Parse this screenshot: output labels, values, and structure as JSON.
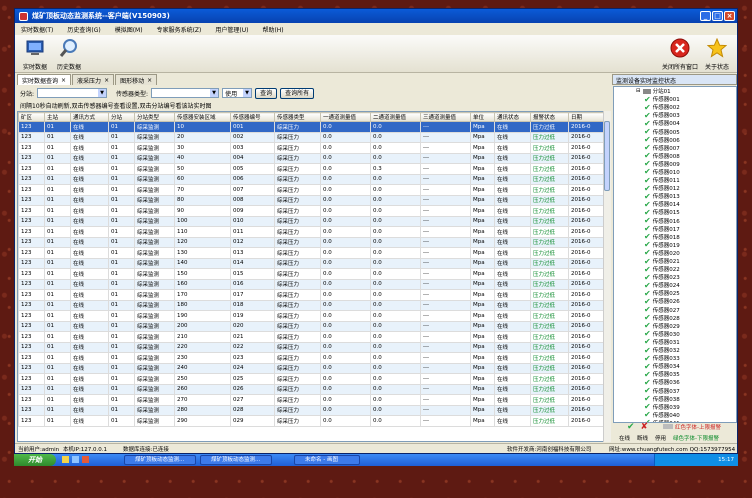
{
  "window": {
    "title": "煤矿顶板动态监测系统--客户端(V150903)"
  },
  "menu": [
    "实时数据(T)",
    "历史查询(G)",
    "模拟图(M)",
    "专家服务系统(Z)",
    "用户管理(U)",
    "帮助(H)"
  ],
  "toolbar": {
    "realtime": "实时数据",
    "history": "历史数据",
    "close_all": "关闭所有窗口",
    "about": "关于状态"
  },
  "tabs": [
    "实时数据查询",
    "液采压力",
    "图形移动"
  ],
  "right_header": "监测设备实时监控状态",
  "filter": {
    "substation_label": "分站:",
    "sensor_type_label": "传感器类型:",
    "use_value": "使用",
    "query_btn": "查询",
    "query_all_btn": "查询所有"
  },
  "hint": "间隔10秒自动刷新,双击传感器编号查看设置,双击分站编号看该站实时图",
  "grid": {
    "columns": [
      "矿区",
      "主站",
      "通讯方式",
      "分站",
      "分站类型",
      "传感器安装区域",
      "传感器编号",
      "传感器类型",
      "一通道测量值",
      "二通道测量值",
      "三通道测量值",
      "单位",
      "通讯状态",
      "报警状态",
      "日期"
    ],
    "rows": [
      [
        "123",
        "01",
        "在线",
        "01",
        "综采监测",
        "10",
        "001",
        "综采压力",
        "0.0",
        "0.0",
        "---",
        "Mpa",
        "在线",
        "压力过低",
        "2016-0"
      ],
      [
        "123",
        "01",
        "在线",
        "01",
        "综采监测",
        "20",
        "002",
        "综采压力",
        "0.0",
        "0.0",
        "---",
        "Mpa",
        "在线",
        "压力过低",
        "2016-0"
      ],
      [
        "123",
        "01",
        "在线",
        "01",
        "综采监测",
        "30",
        "003",
        "综采压力",
        "0.0",
        "0.0",
        "---",
        "Mpa",
        "在线",
        "压力过低",
        "2016-0"
      ],
      [
        "123",
        "01",
        "在线",
        "01",
        "综采监测",
        "40",
        "004",
        "综采压力",
        "0.0",
        "0.0",
        "---",
        "Mpa",
        "在线",
        "压力过低",
        "2016-0"
      ],
      [
        "123",
        "01",
        "在线",
        "01",
        "综采监测",
        "50",
        "005",
        "综采压力",
        "0.0",
        "0.3",
        "---",
        "Mpa",
        "在线",
        "压力过低",
        "2016-0"
      ],
      [
        "123",
        "01",
        "在线",
        "01",
        "综采监测",
        "60",
        "006",
        "综采压力",
        "0.0",
        "0.0",
        "---",
        "Mpa",
        "在线",
        "压力过低",
        "2016-0"
      ],
      [
        "123",
        "01",
        "在线",
        "01",
        "综采监测",
        "70",
        "007",
        "综采压力",
        "0.0",
        "0.0",
        "---",
        "Mpa",
        "在线",
        "压力过低",
        "2016-0"
      ],
      [
        "123",
        "01",
        "在线",
        "01",
        "综采监测",
        "80",
        "008",
        "综采压力",
        "0.0",
        "0.0",
        "---",
        "Mpa",
        "在线",
        "压力过低",
        "2016-0"
      ],
      [
        "123",
        "01",
        "在线",
        "01",
        "综采监测",
        "90",
        "009",
        "综采压力",
        "0.0",
        "0.0",
        "---",
        "Mpa",
        "在线",
        "压力过低",
        "2016-0"
      ],
      [
        "123",
        "01",
        "在线",
        "01",
        "综采监测",
        "100",
        "010",
        "综采压力",
        "0.0",
        "0.0",
        "---",
        "Mpa",
        "在线",
        "压力过低",
        "2016-0"
      ],
      [
        "123",
        "01",
        "在线",
        "01",
        "综采监测",
        "110",
        "011",
        "综采压力",
        "0.0",
        "0.0",
        "---",
        "Mpa",
        "在线",
        "压力过低",
        "2016-0"
      ],
      [
        "123",
        "01",
        "在线",
        "01",
        "综采监测",
        "120",
        "012",
        "综采压力",
        "0.0",
        "0.0",
        "---",
        "Mpa",
        "在线",
        "压力过低",
        "2016-0"
      ],
      [
        "123",
        "01",
        "在线",
        "01",
        "综采监测",
        "130",
        "013",
        "综采压力",
        "0.0",
        "0.0",
        "---",
        "Mpa",
        "在线",
        "压力过低",
        "2016-0"
      ],
      [
        "123",
        "01",
        "在线",
        "01",
        "综采监测",
        "140",
        "014",
        "综采压力",
        "0.0",
        "0.0",
        "---",
        "Mpa",
        "在线",
        "压力过低",
        "2016-0"
      ],
      [
        "123",
        "01",
        "在线",
        "01",
        "综采监测",
        "150",
        "015",
        "综采压力",
        "0.0",
        "0.0",
        "---",
        "Mpa",
        "在线",
        "压力过低",
        "2016-0"
      ],
      [
        "123",
        "01",
        "在线",
        "01",
        "综采监测",
        "160",
        "016",
        "综采压力",
        "0.0",
        "0.0",
        "---",
        "Mpa",
        "在线",
        "压力过低",
        "2016-0"
      ],
      [
        "123",
        "01",
        "在线",
        "01",
        "综采监测",
        "170",
        "017",
        "综采压力",
        "0.0",
        "0.0",
        "---",
        "Mpa",
        "在线",
        "压力过低",
        "2016-0"
      ],
      [
        "123",
        "01",
        "在线",
        "01",
        "综采监测",
        "180",
        "018",
        "综采压力",
        "0.0",
        "0.0",
        "---",
        "Mpa",
        "在线",
        "压力过低",
        "2016-0"
      ],
      [
        "123",
        "01",
        "在线",
        "01",
        "综采监测",
        "190",
        "019",
        "综采压力",
        "0.0",
        "0.0",
        "---",
        "Mpa",
        "在线",
        "压力过低",
        "2016-0"
      ],
      [
        "123",
        "01",
        "在线",
        "01",
        "综采监测",
        "200",
        "020",
        "综采压力",
        "0.0",
        "0.0",
        "---",
        "Mpa",
        "在线",
        "压力过低",
        "2016-0"
      ],
      [
        "123",
        "01",
        "在线",
        "01",
        "综采监测",
        "210",
        "021",
        "综采压力",
        "0.0",
        "0.0",
        "---",
        "Mpa",
        "在线",
        "压力过低",
        "2016-0"
      ],
      [
        "123",
        "01",
        "在线",
        "01",
        "综采监测",
        "220",
        "022",
        "综采压力",
        "0.0",
        "0.0",
        "---",
        "Mpa",
        "在线",
        "压力过低",
        "2016-0"
      ],
      [
        "123",
        "01",
        "在线",
        "01",
        "综采监测",
        "230",
        "023",
        "综采压力",
        "0.0",
        "0.0",
        "---",
        "Mpa",
        "在线",
        "压力过低",
        "2016-0"
      ],
      [
        "123",
        "01",
        "在线",
        "01",
        "综采监测",
        "240",
        "024",
        "综采压力",
        "0.0",
        "0.0",
        "---",
        "Mpa",
        "在线",
        "压力过低",
        "2016-0"
      ],
      [
        "123",
        "01",
        "在线",
        "01",
        "综采监测",
        "250",
        "025",
        "综采压力",
        "0.0",
        "0.0",
        "---",
        "Mpa",
        "在线",
        "压力过低",
        "2016-0"
      ],
      [
        "123",
        "01",
        "在线",
        "01",
        "综采监测",
        "260",
        "026",
        "综采压力",
        "0.0",
        "0.0",
        "---",
        "Mpa",
        "在线",
        "压力过低",
        "2016-0"
      ],
      [
        "123",
        "01",
        "在线",
        "01",
        "综采监测",
        "270",
        "027",
        "综采压力",
        "0.0",
        "0.0",
        "---",
        "Mpa",
        "在线",
        "压力过低",
        "2016-0"
      ],
      [
        "123",
        "01",
        "在线",
        "01",
        "综采监测",
        "280",
        "028",
        "综采压力",
        "0.0",
        "0.0",
        "---",
        "Mpa",
        "在线",
        "压力过低",
        "2016-0"
      ],
      [
        "123",
        "01",
        "在线",
        "01",
        "综采监测",
        "290",
        "029",
        "综采压力",
        "0.0",
        "0.0",
        "---",
        "Mpa",
        "在线",
        "压力过低",
        "2016-0"
      ]
    ]
  },
  "tree": {
    "root": "分站01",
    "items": [
      "传感器001",
      "传感器002",
      "传感器003",
      "传感器004",
      "传感器005",
      "传感器006",
      "传感器007",
      "传感器008",
      "传感器009",
      "传感器010",
      "传感器011",
      "传感器012",
      "传感器013",
      "传感器014",
      "传感器015",
      "传感器016",
      "传感器017",
      "传感器018",
      "传感器019",
      "传感器020",
      "传感器021",
      "传感器022",
      "传感器023",
      "传感器024",
      "传感器025",
      "传感器026",
      "传感器027",
      "传感器028",
      "传感器029",
      "传感器030",
      "传感器031",
      "传感器032",
      "传感器033",
      "传感器034",
      "传感器035",
      "传感器036",
      "传感器037",
      "传感器038",
      "传感器039",
      "传感器040",
      "传感器041"
    ]
  },
  "legend": {
    "online": "在线",
    "offline": "断线",
    "stopped": "停用",
    "red_text": "红色字体-上限报警",
    "green_text": "绿色字体-下限报警"
  },
  "status": {
    "user": "当前用户:admin",
    "ip": "本机IP:127.0.0.1",
    "db": "数据库连接:已连接",
    "developer": "软件开发商:河南创福科技有限公司",
    "website": "网址:www.chuangfutech.com QQ:1573977954"
  },
  "taskbar": {
    "start": "开始",
    "tasks": [
      "煤矿顶板动态监测...",
      "煤矿顶板动态监测...",
      "未命名 - 画图"
    ],
    "clock": "15:17"
  },
  "colors": {
    "selected": "#3168c6",
    "alt_row": "#e8f2fb",
    "alarm_text": "#0a8a2a"
  }
}
